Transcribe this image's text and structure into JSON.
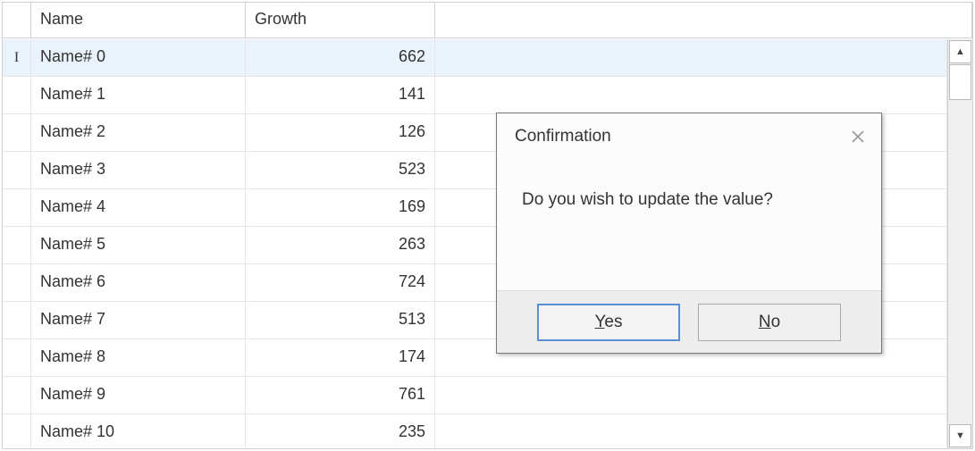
{
  "grid": {
    "columns": {
      "name": "Name",
      "growth": "Growth"
    },
    "rows": [
      {
        "name": "Name# 0",
        "growth": "662",
        "selected": true
      },
      {
        "name": "Name# 1",
        "growth": "141",
        "selected": false
      },
      {
        "name": "Name# 2",
        "growth": "126",
        "selected": false
      },
      {
        "name": "Name# 3",
        "growth": "523",
        "selected": false
      },
      {
        "name": "Name# 4",
        "growth": "169",
        "selected": false
      },
      {
        "name": "Name# 5",
        "growth": "263",
        "selected": false
      },
      {
        "name": "Name# 6",
        "growth": "724",
        "selected": false
      },
      {
        "name": "Name# 7",
        "growth": "513",
        "selected": false
      },
      {
        "name": "Name# 8",
        "growth": "174",
        "selected": false
      },
      {
        "name": "Name# 9",
        "growth": "761",
        "selected": false
      },
      {
        "name": "Name# 10",
        "growth": "235",
        "selected": false
      }
    ]
  },
  "dialog": {
    "title": "Confirmation",
    "message": "Do you wish to update the value?",
    "buttons": {
      "yes": "Yes",
      "no": "No"
    }
  },
  "icons": {
    "scroll_up": "▲",
    "scroll_down": "▼",
    "edit_cursor": "I"
  }
}
